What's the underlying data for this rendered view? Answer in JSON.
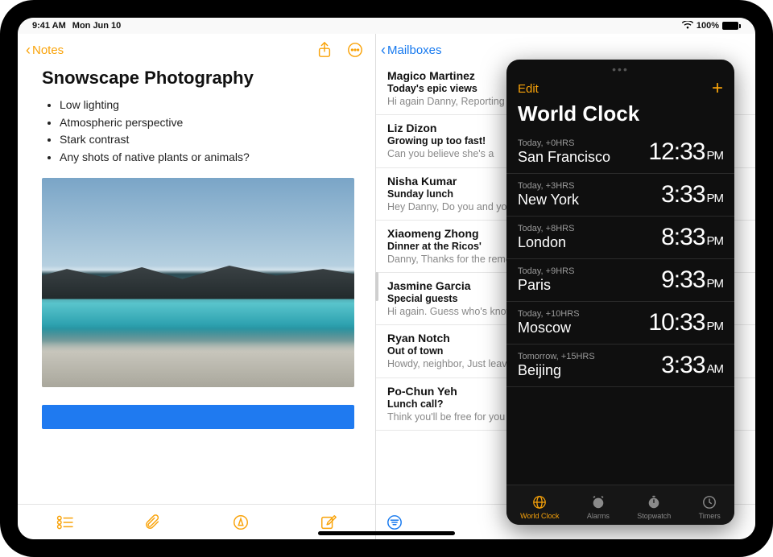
{
  "statusbar": {
    "time": "9:41 AM",
    "date": "Mon Jun 10",
    "battery": "100%"
  },
  "notes": {
    "back_label": "Notes",
    "title": "Snowscape Photography",
    "bullets": [
      "Low lighting",
      "Atmospheric perspective",
      "Stark contrast",
      "Any shots of native plants or animals?"
    ]
  },
  "mail": {
    "back_label": "Mailboxes",
    "messages": [
      {
        "sender": "Magico Martinez",
        "subject": "Today's epic views",
        "preview": "Hi again Danny, Reporting from the field. Wide open skies, a gen"
      },
      {
        "sender": "Liz Dizon",
        "subject": "Growing up too fast!",
        "preview": "Can you believe she's a"
      },
      {
        "sender": "Nisha Kumar",
        "subject": "Sunday lunch",
        "preview": "Hey Danny, Do you and your dad? If you two join, th"
      },
      {
        "sender": "Xiaomeng Zhong",
        "subject": "Dinner at the Ricos'",
        "preview": "Danny, Thanks for the remembered to take on"
      },
      {
        "sender": "Jasmine Garcia",
        "subject": "Special guests",
        "preview": "Hi again. Guess who's know how to make me"
      },
      {
        "sender": "Ryan Notch",
        "subject": "Out of town",
        "preview": "Howdy, neighbor, Just leaving Tuesday and w"
      },
      {
        "sender": "Po-Chun Yeh",
        "subject": "Lunch call?",
        "preview": "Think you'll be free for you think might work a"
      }
    ]
  },
  "clock": {
    "edit_label": "Edit",
    "title": "World Clock",
    "cities": [
      {
        "offset": "Today, +0HRS",
        "city": "San Francisco",
        "time": "12:33",
        "ampm": "PM"
      },
      {
        "offset": "Today, +3HRS",
        "city": "New York",
        "time": "3:33",
        "ampm": "PM"
      },
      {
        "offset": "Today, +8HRS",
        "city": "London",
        "time": "8:33",
        "ampm": "PM"
      },
      {
        "offset": "Today, +9HRS",
        "city": "Paris",
        "time": "9:33",
        "ampm": "PM"
      },
      {
        "offset": "Today, +10HRS",
        "city": "Moscow",
        "time": "10:33",
        "ampm": "PM"
      },
      {
        "offset": "Tomorrow, +15HRS",
        "city": "Beijing",
        "time": "3:33",
        "ampm": "AM"
      }
    ],
    "tabs": [
      {
        "label": "World Clock",
        "active": true
      },
      {
        "label": "Alarms",
        "active": false
      },
      {
        "label": "Stopwatch",
        "active": false
      },
      {
        "label": "Timers",
        "active": false
      }
    ]
  }
}
